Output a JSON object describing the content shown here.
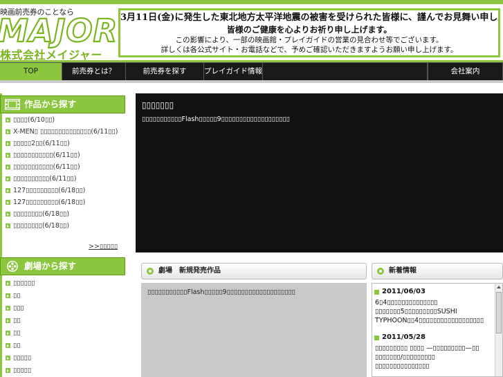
{
  "header": {
    "tagline": "映画前売券のことなら",
    "logo_text": "MAJOR",
    "company_name": "株式会社メイジャー",
    "notice": {
      "line1": "3月11日(金)に発生した東北地方太平洋地震の被害を受けられた皆様に、謹んでお見舞い申し上げます。",
      "line2": "皆様のご健康を心よりお祈り申し上げます。",
      "line3": "この影響により、一部の映画館・プレイガイドの営業の見合わせ等でございます。",
      "line4": "詳しくは各公式サイト・お電話などで、予めご確認いただきますようお願い申し上げます。"
    }
  },
  "nav": {
    "items": [
      {
        "label": "TOP"
      },
      {
        "label": "前売券とは？"
      },
      {
        "label": "前売券を探す"
      },
      {
        "label": "プレイガイド情報"
      },
      {
        "label": ""
      },
      {
        "label": "会社案内"
      }
    ]
  },
  "sidebar": {
    "works_heading": "作品から探す",
    "works": [
      "▯▯▯▯(6/10▯▯)",
      "X-MEN▯ ▯▯▯▯▯▯▯▯▯▯▯▯▯▯(6/11▯▯)",
      "▯▯▯▯▯2▯▯(6/11▯▯)",
      "▯▯▯▯▯▯▯▯▯▯▯(6/11▯▯)",
      "▯▯▯▯▯▯▯▯▯▯▯(6/11▯▯)",
      "▯▯▯▯▯▯▯▯▯▯(6/11▯▯)",
      "127▯▯▯▯▯▯▯▯▯(6/18▯▯)",
      "127▯▯▯▯▯▯▯▯▯(6/18▯▯)",
      "▯▯▯▯▯▯▯▯(6/18▯▯)",
      "▯▯▯▯▯▯▯▯(6/18▯▯)"
    ],
    "more_label": ">>▯▯▯▯▯",
    "theaters_heading": "劇場から探す",
    "theaters": [
      "▯▯▯▯▯▯",
      "▯▯",
      "▯▯▯",
      "▯▯",
      "▯▯",
      "▯▯",
      "▯▯▯▯▯",
      "▯▯▯▯▯"
    ]
  },
  "flash": {
    "title": "▯▯▯▯▯▯▯",
    "message": "▯▯▯▯▯▯▯▯▯▯▯Flash▯▯▯▯▯9▯▯▯▯▯▯▯▯▯▯▯▯▯▯▯▯▯▯▯"
  },
  "gallery": {
    "heading": "劇場　新規発売作品",
    "message": "▯▯▯▯▯▯▯▯▯▯▯Flash▯▯▯▯▯9▯▯▯▯▯▯▯▯▯▯▯▯▯▯▯▯▯▯▯"
  },
  "news": {
    "heading": "新着情報",
    "entries": [
      {
        "date": "2011/06/03",
        "text": "6▯4▯▯▯▯▯▯▯▯▯▯▯▯▯▯ ▯▯▯▯▯▯▯5▯▯▯▯▯▯▯▯▯SUSHI TYPHOON▯▯4▯▯▯▯▯▯▯▯▯▯▯▯▯▯▯▯▯▯"
      },
      {
        "date": "2011/05/28",
        "text": "▯▯▯▯▯▯▯▯▯ ▯▯▯▯ —▯▯▯▯▯▯▯▯▯—▯▯ ▯▯▯▯▯▯▯/▯▯▯▯▯▯▯▯▯ ▯▯▯▯▯▯▯▯▯▯▯▯▯▯▯"
      }
    ]
  },
  "colors": {
    "brand_green": "#8cc63f",
    "nav_background": "#1a1a1a",
    "flash_background": "#111111"
  }
}
